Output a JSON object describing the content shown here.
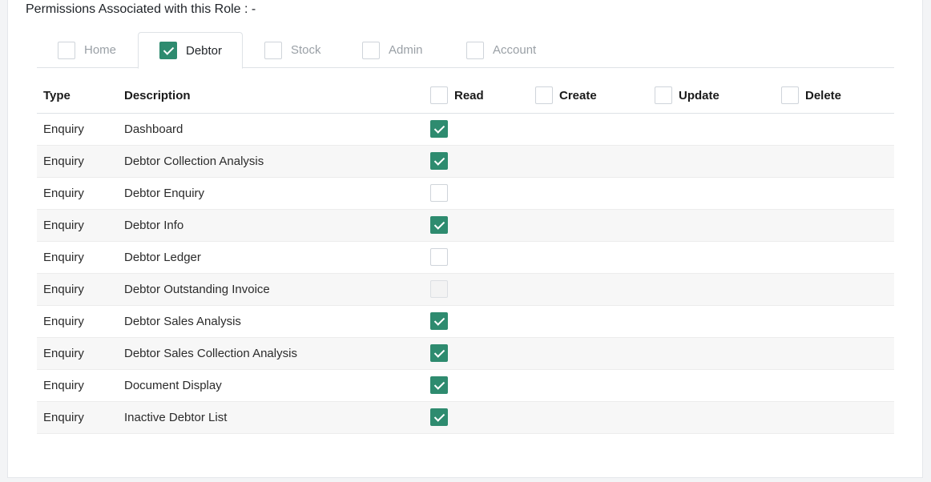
{
  "section": {
    "title": "Permissions Associated with this Role : -"
  },
  "tabs": [
    {
      "label": "Home",
      "checked": false
    },
    {
      "label": "Debtor",
      "checked": true
    },
    {
      "label": "Stock",
      "checked": false
    },
    {
      "label": "Admin",
      "checked": false
    },
    {
      "label": "Account",
      "checked": false
    }
  ],
  "table": {
    "headers": {
      "type": "Type",
      "description": "Description",
      "read": "Read",
      "create": "Create",
      "update": "Update",
      "delete": "Delete"
    },
    "rows": [
      {
        "type": "Enquiry",
        "description": "Dashboard",
        "read": "checked"
      },
      {
        "type": "Enquiry",
        "description": "Debtor Collection Analysis",
        "read": "checked"
      },
      {
        "type": "Enquiry",
        "description": "Debtor Enquiry",
        "read": "unchecked"
      },
      {
        "type": "Enquiry",
        "description": "Debtor Info",
        "read": "checked"
      },
      {
        "type": "Enquiry",
        "description": "Debtor Ledger",
        "read": "unchecked"
      },
      {
        "type": "Enquiry",
        "description": "Debtor Outstanding Invoice",
        "read": "disabled"
      },
      {
        "type": "Enquiry",
        "description": "Debtor Sales Analysis",
        "read": "checked"
      },
      {
        "type": "Enquiry",
        "description": "Debtor Sales Collection Analysis",
        "read": "checked"
      },
      {
        "type": "Enquiry",
        "description": "Document Display",
        "read": "checked"
      },
      {
        "type": "Enquiry",
        "description": "Inactive Debtor List",
        "read": "checked"
      }
    ]
  },
  "colors": {
    "accent": "#2e8b6f",
    "tab_inactive_text": "#9aa0a6",
    "stripe": "#f7f7f7"
  }
}
